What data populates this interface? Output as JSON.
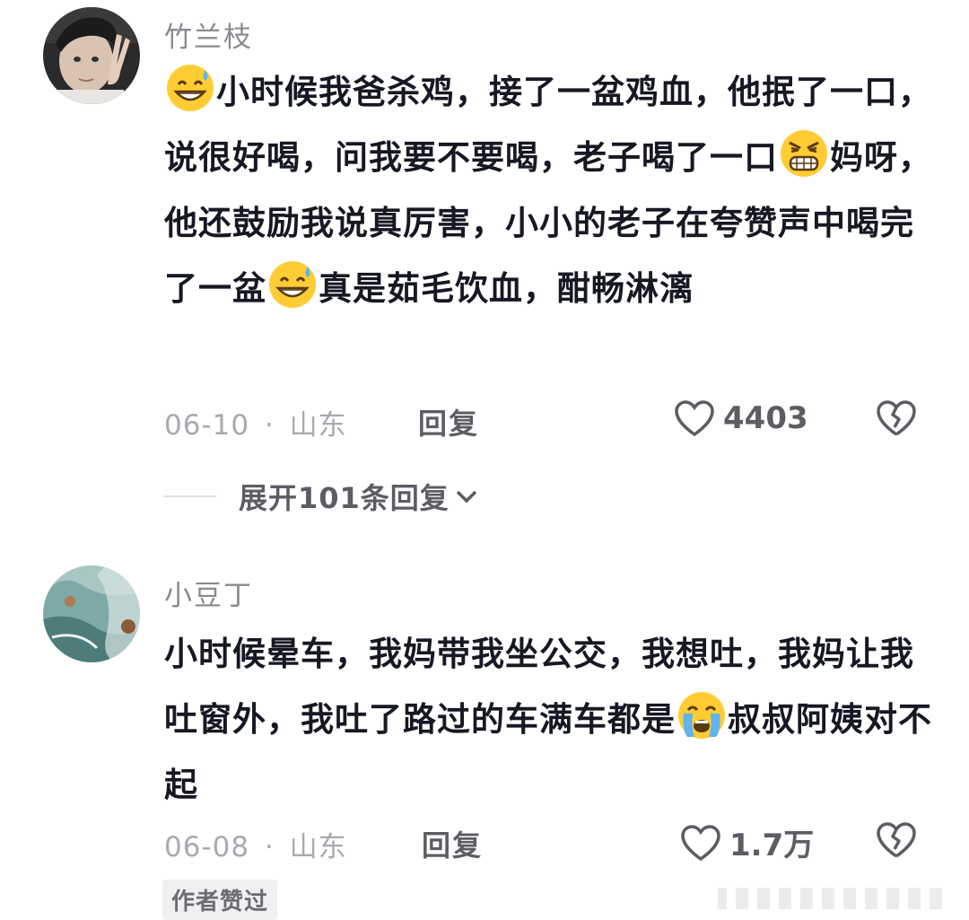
{
  "comments": [
    {
      "username": "竹兰枝",
      "text": {
        "p1": "小时候我爸杀鸡，接了一盆鸡血，他抿了一口，说很好喝，问我要不要喝，老子喝了一口",
        "p2": "妈呀，他还鼓励我说真厉害，小小的老子在夸赞声中喝完了一盆",
        "p3": "真是茹毛饮血，酣畅淋漓"
      },
      "emojis": [
        "grin-sweat-emoji",
        "grimace-emoji",
        "grin-sweat-emoji"
      ],
      "date": "06-10",
      "separator": "·",
      "location": "山东",
      "reply_label": "回复",
      "likes": "4403"
    },
    {
      "username": "小豆丁",
      "text": {
        "p1": "小时候晕车，我妈带我坐公交，我想吐，我妈让我吐窗外，我吐了路过的车满车都是",
        "p2": "叔叔阿姨对不起"
      },
      "emojis": [
        "crying-emoji"
      ],
      "date": "06-08",
      "separator": "·",
      "location": "山东",
      "reply_label": "回复",
      "likes": "1.7万",
      "author_badge": "作者赞过"
    }
  ],
  "expand_replies": "展开101条回复",
  "colors": {
    "text": "#161823",
    "muted": "#a9aab0",
    "username": "#8a8b91",
    "action": "#5c5d63",
    "emoji_face": "#ffcc33"
  }
}
